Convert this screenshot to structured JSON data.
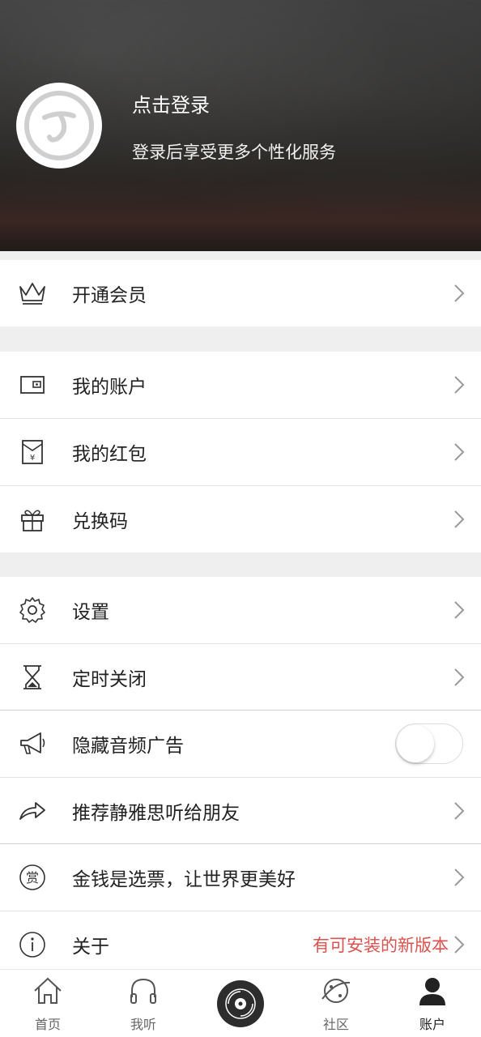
{
  "header": {
    "login_title": "点击登录",
    "login_subtitle": "登录后享受更多个性化服务"
  },
  "menu": {
    "vip": {
      "label": "开通会员",
      "icon": "crown-icon"
    },
    "account": {
      "label": "我的账户",
      "icon": "wallet-icon"
    },
    "red_packet": {
      "label": "我的红包",
      "icon": "red-envelope-icon"
    },
    "redeem": {
      "label": "兑换码",
      "icon": "gift-icon"
    },
    "settings": {
      "label": "设置",
      "icon": "gear-icon"
    },
    "timer": {
      "label": "定时关闭",
      "icon": "hourglass-icon"
    },
    "hide_ads": {
      "label": "隐藏音频广告",
      "icon": "megaphone-icon",
      "toggle_on": false
    },
    "recommend": {
      "label": "推荐静雅思听给朋友",
      "icon": "share-arrow-icon"
    },
    "reward": {
      "label": "金钱是选票，让世界更美好",
      "icon": "reward-icon",
      "icon_text": "赏"
    },
    "about": {
      "label": "关于",
      "icon": "info-icon",
      "badge": "有可安装的新版本",
      "badge_color": "#d9534f"
    }
  },
  "tabbar": {
    "home": "首页",
    "listen": "我听",
    "community": "社区",
    "account": "账户",
    "active": "account"
  }
}
